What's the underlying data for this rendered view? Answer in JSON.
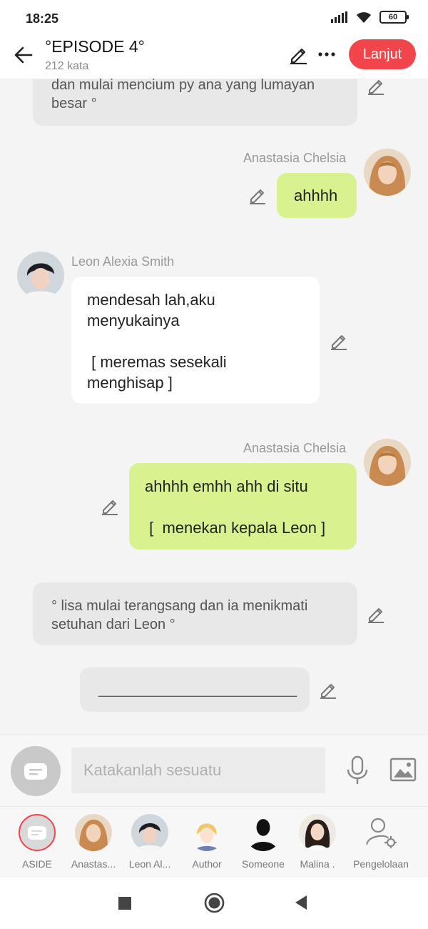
{
  "status": {
    "time": "18:25",
    "battery": "60"
  },
  "header": {
    "title": "°EPISODE 4°",
    "word_count": "212 kata",
    "continue_label": "Lanjut"
  },
  "messages": {
    "narr1": "dan mulai mencium py ana yang lumayan besar °",
    "m1_name": "Anastasia Chelsia",
    "m1_text": "ahhhh",
    "m2_name": "Leon Alexia Smith",
    "m2_line1": "mendesah lah,aku",
    "m2_line2": "menyukainya",
    "m2_line3": " [ meremas sesekali",
    "m2_line4": "menghisap ]",
    "m3_name": "Anastasia Chelsia",
    "m3_line1": "ahhhh emhh ahh di situ",
    "m3_line2": " [  menekan kepala Leon ]",
    "narr2": "° lisa mulai terangsang dan ia menikmati setuhan dari Leon °",
    "narr3": "_________________________"
  },
  "composer": {
    "placeholder": "Katakanlah sesuatu"
  },
  "characters": [
    {
      "label": "ASIDE",
      "icon": "chat-icon"
    },
    {
      "label": "Anastas...",
      "icon": "avatar-anastasia"
    },
    {
      "label": "Leon Al...",
      "icon": "avatar-leon"
    },
    {
      "label": "Author",
      "icon": "avatar-author"
    },
    {
      "label": "Someone",
      "icon": "avatar-someone"
    },
    {
      "label": "Malina .",
      "icon": "avatar-malina"
    },
    {
      "label": "Pengelolaan",
      "icon": "manage-icon"
    }
  ],
  "colors": {
    "accent": "#f2454b",
    "my_bubble": "#d7f28f",
    "other_bubble": "#ffffff",
    "narration": "#e8e8e8"
  }
}
